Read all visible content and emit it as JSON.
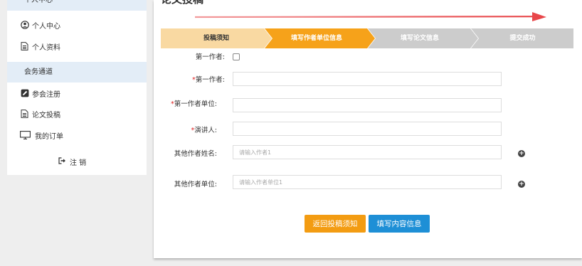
{
  "sidebar": {
    "section_personal": "个人中心",
    "personal_items": [
      {
        "label": "个人中心",
        "icon": "user-circle-icon"
      },
      {
        "label": "个人资料",
        "icon": "document-icon"
      }
    ],
    "section_meeting": "会务通道",
    "meeting_items": [
      {
        "label": "参会注册",
        "icon": "edit-icon"
      },
      {
        "label": "论文投稿",
        "icon": "document-icon"
      },
      {
        "label": "我的订单",
        "icon": "monitor-icon"
      }
    ],
    "logout_label": "注 销"
  },
  "main": {
    "title": "论文投稿",
    "steps": [
      {
        "label": "投稿须知",
        "state": "done"
      },
      {
        "label": "填写作者单位信息",
        "state": "active"
      },
      {
        "label": "填写论文信息",
        "state": "pending"
      },
      {
        "label": "提交成功",
        "state": "pending"
      }
    ],
    "form": {
      "first_author_checkbox_label": "第一作者:",
      "first_author_label": "第一作者:",
      "first_author_value": "",
      "first_author_unit_label": "第一作者单位:",
      "first_author_unit_value": "",
      "speaker_label": "演讲人:",
      "speaker_value": "",
      "other_author_name_label": "其他作者姓名:",
      "other_author_name_placeholder": "请输入作者1",
      "other_author_unit_label": "其他作者单位:",
      "other_author_unit_placeholder": "请输入作者单位1",
      "required_mark": "*",
      "add_symbol": "+"
    },
    "buttons": {
      "back_label": "返回投稿须知",
      "next_label": "填写内容信息"
    }
  },
  "colors": {
    "step_done": "#f9d9a2",
    "step_active": "#f6a21a",
    "step_pending": "#cccccc",
    "arrow": "#e8474a",
    "btn_back": "#f39c12",
    "btn_next": "#1e8fd6",
    "sidebar_section": "#e3edf7"
  }
}
